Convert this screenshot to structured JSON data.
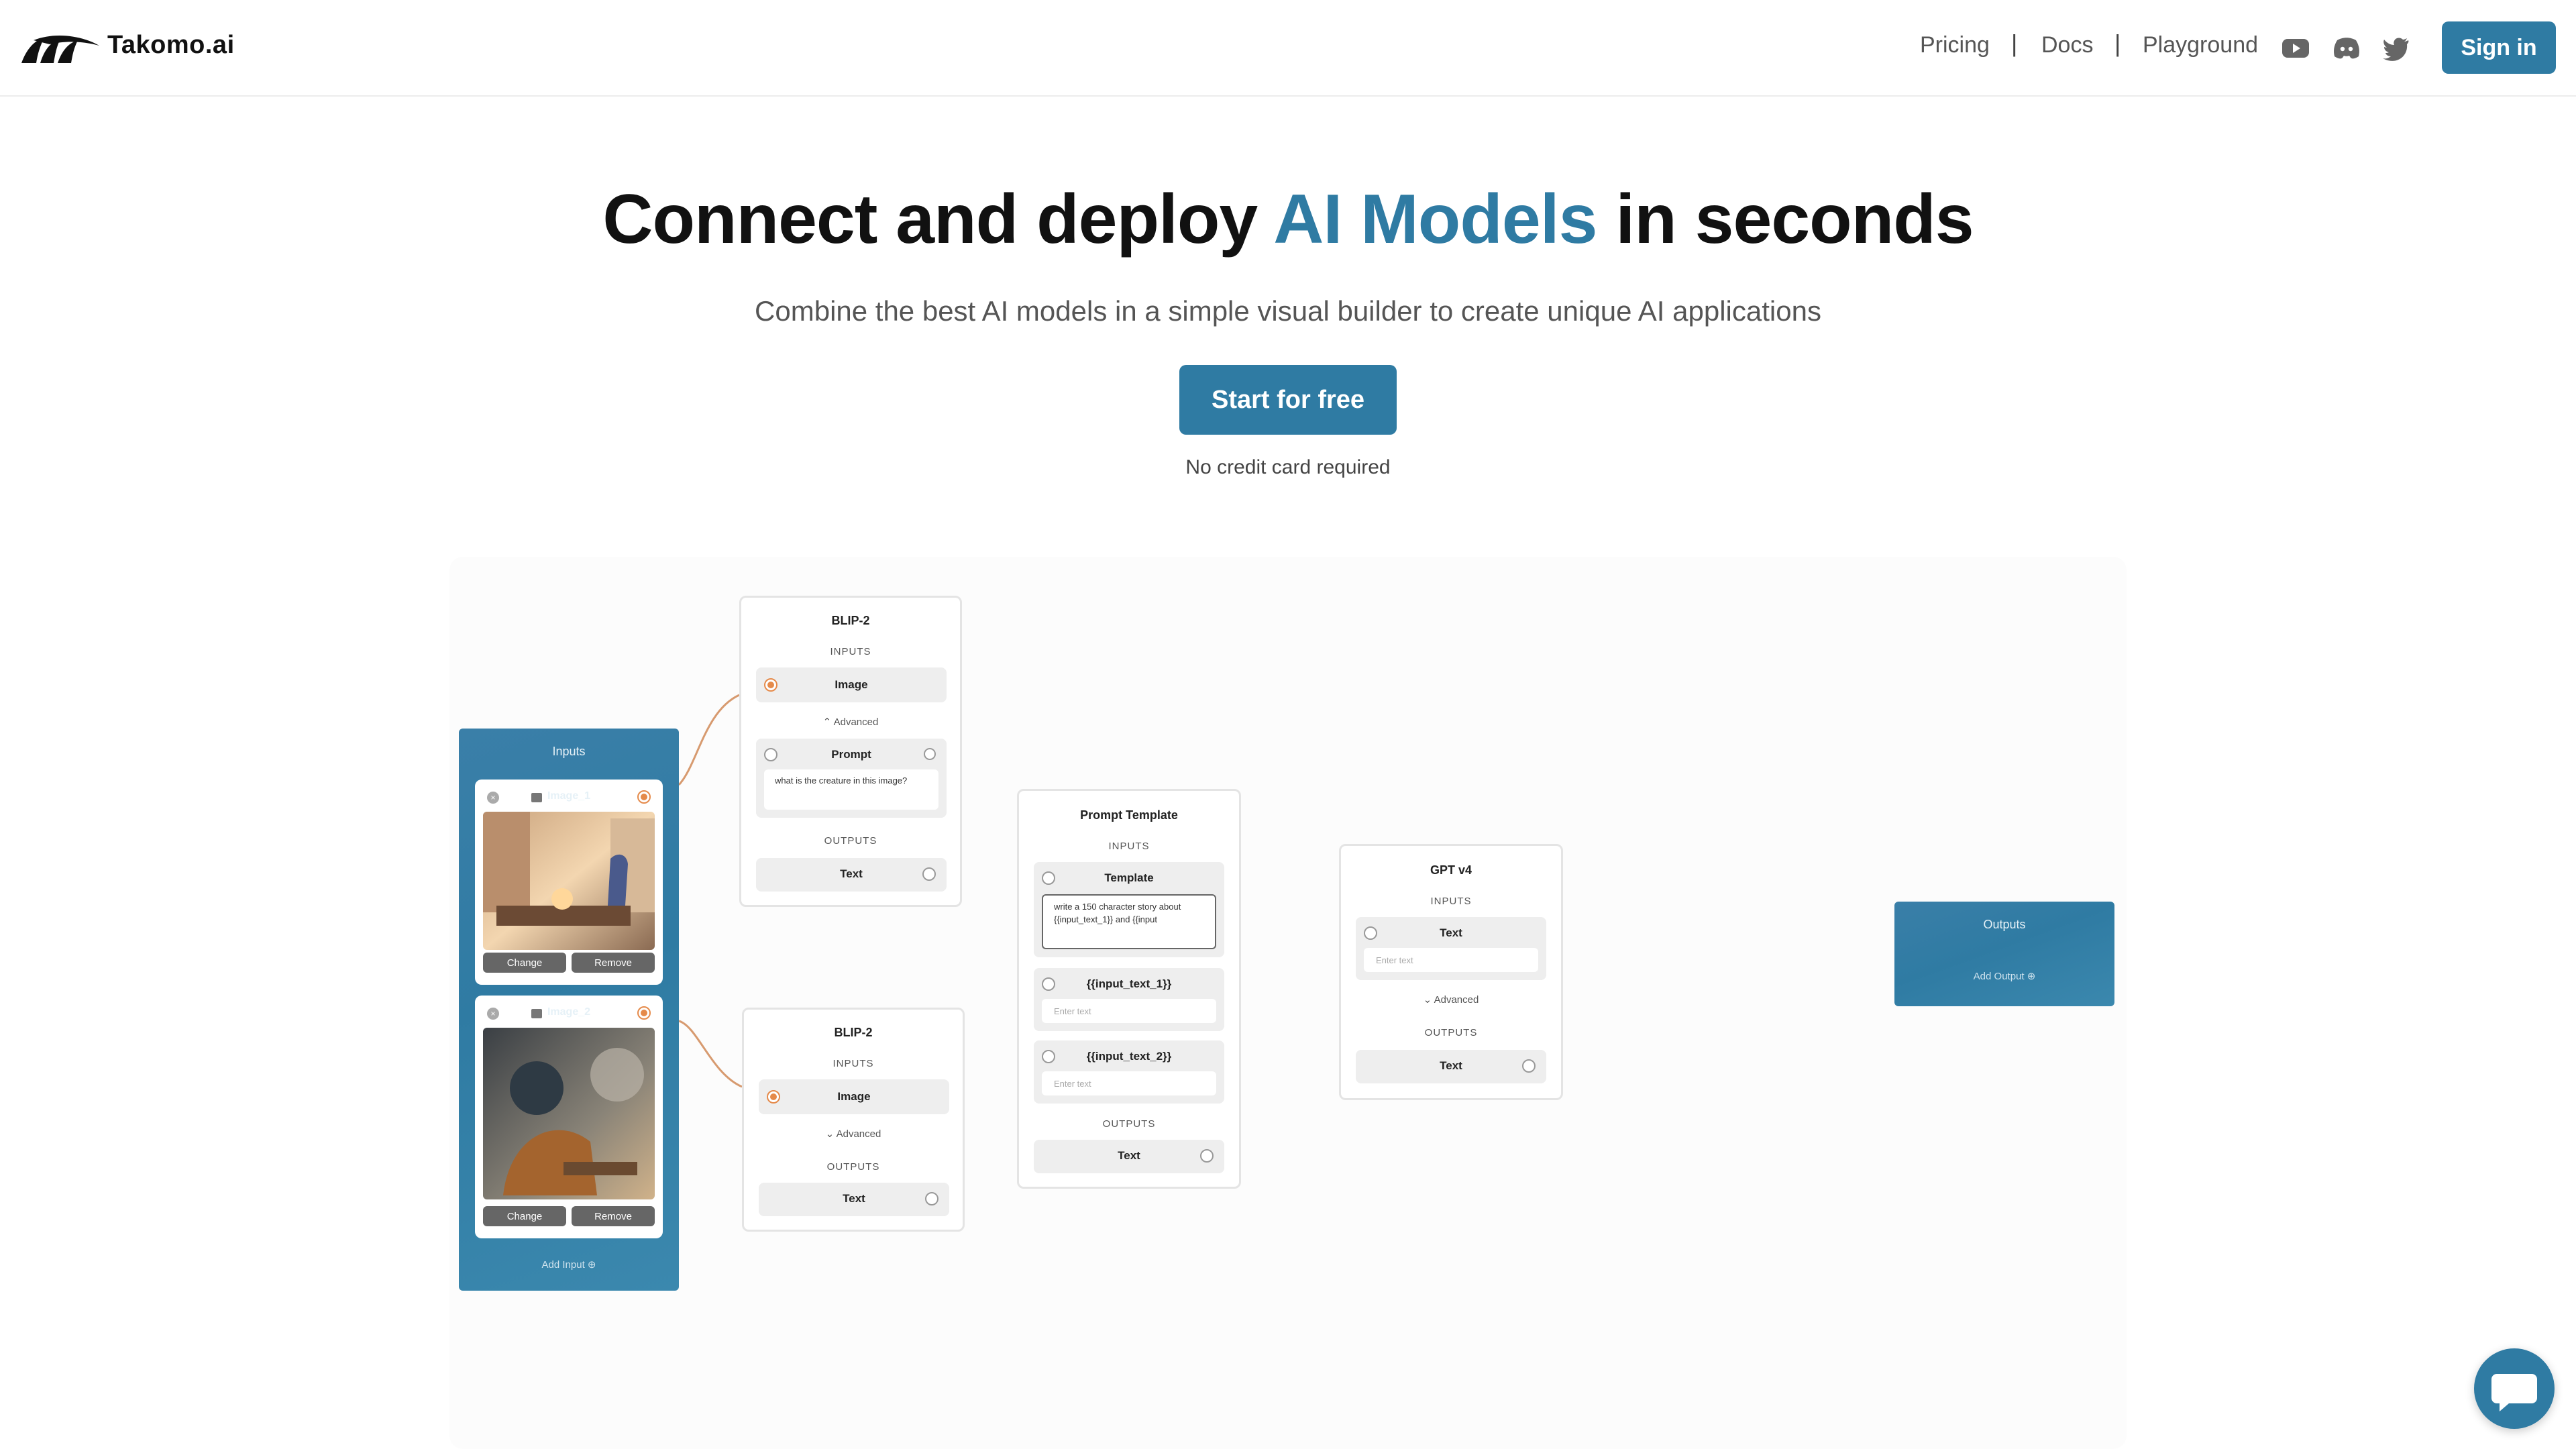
{
  "header": {
    "brand": "Takomo.ai",
    "nav": {
      "pricing": "Pricing",
      "docs": "Docs",
      "playground": "Playground",
      "separator": "|"
    },
    "social_icons": [
      "youtube-icon",
      "discord-icon",
      "twitter-icon"
    ],
    "sign_in": "Sign in"
  },
  "hero": {
    "title_pre": "Connect and deploy ",
    "title_accent": "AI Models",
    "title_post": " in seconds",
    "subtitle": "Combine the best AI models in a simple visual builder to create unique AI applications",
    "cta": "Start for free",
    "note": "No credit card required"
  },
  "colors": {
    "accent": "#2f7ba3",
    "connector": "#e58a4a",
    "text": "#111111"
  },
  "builder": {
    "inputs_node": {
      "title": "Inputs",
      "cards": [
        {
          "name": "Image_1",
          "change": "Change",
          "remove": "Remove"
        },
        {
          "name": "Image_2",
          "change": "Change",
          "remove": "Remove"
        }
      ],
      "add_input": "Add Input"
    },
    "blip_top": {
      "title": "BLIP-2",
      "inputs": "INPUTS",
      "image": "Image",
      "advanced": "Advanced",
      "prompt": "Prompt",
      "prompt_value": "what is the creature in this image?",
      "outputs": "OUTPUTS",
      "text": "Text"
    },
    "blip_bottom": {
      "title": "BLIP-2",
      "inputs": "INPUTS",
      "image": "Image",
      "advanced": "Advanced",
      "outputs": "OUTPUTS",
      "text": "Text"
    },
    "prompt_template": {
      "title": "Prompt Template",
      "inputs": "INPUTS",
      "template": "Template",
      "template_value": "write a 150 character story about {{input_text_1}} and {{input",
      "var1": "{{input_text_1}}",
      "var2": "{{input_text_2}}",
      "placeholder": "Enter text",
      "outputs": "OUTPUTS",
      "text": "Text"
    },
    "gpt": {
      "title": "GPT v4",
      "inputs": "INPUTS",
      "text_in": "Text",
      "placeholder": "Enter text",
      "advanced": "Advanced",
      "outputs": "OUTPUTS",
      "text_out": "Text"
    },
    "outputs_node": {
      "title": "Outputs",
      "add_output": "Add Output"
    }
  }
}
